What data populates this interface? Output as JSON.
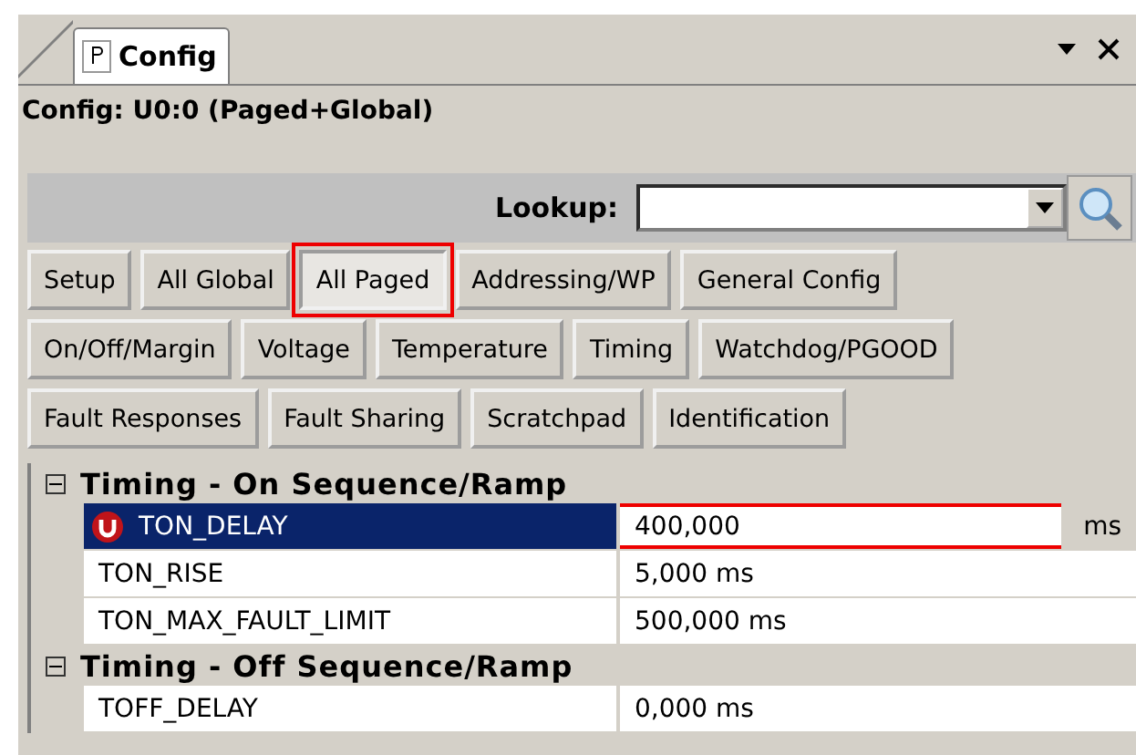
{
  "tab": {
    "label": "Config",
    "selected": true
  },
  "title": "Config: U0:0 (Paged+Global)",
  "lookup": {
    "label": "Lookup:"
  },
  "button_rows": [
    [
      {
        "label": "Setup",
        "selected": false
      },
      {
        "label": "All Global",
        "selected": false
      },
      {
        "label": "All Paged",
        "selected": true
      },
      {
        "label": "Addressing/WP",
        "selected": false
      },
      {
        "label": "General Config",
        "selected": false
      }
    ],
    [
      {
        "label": "On/Off/Margin",
        "selected": false
      },
      {
        "label": "Voltage",
        "selected": false
      },
      {
        "label": "Temperature",
        "selected": false
      },
      {
        "label": "Timing",
        "selected": false
      },
      {
        "label": "Watchdog/PGOOD",
        "selected": false
      }
    ],
    [
      {
        "label": "Fault Responses",
        "selected": false
      },
      {
        "label": "Fault Sharing",
        "selected": false
      },
      {
        "label": "Scratchpad",
        "selected": false
      },
      {
        "label": "Identification",
        "selected": false
      }
    ]
  ],
  "sections": [
    {
      "title": "Timing - On Sequence/Ramp",
      "expanded": true,
      "children": [
        {
          "name": "TON_DELAY",
          "value": "400,000",
          "unit": "ms",
          "selected": true
        },
        {
          "name": "TON_RISE",
          "value": "5,000 ms",
          "selected": false
        },
        {
          "name": "TON_MAX_FAULT_LIMIT",
          "value": "500,000 ms",
          "selected": false
        }
      ]
    },
    {
      "title": "Timing - Off Sequence/Ramp",
      "expanded": true,
      "children": [
        {
          "name": "TOFF_DELAY",
          "value": "0,000 ms",
          "selected": false
        }
      ]
    }
  ]
}
